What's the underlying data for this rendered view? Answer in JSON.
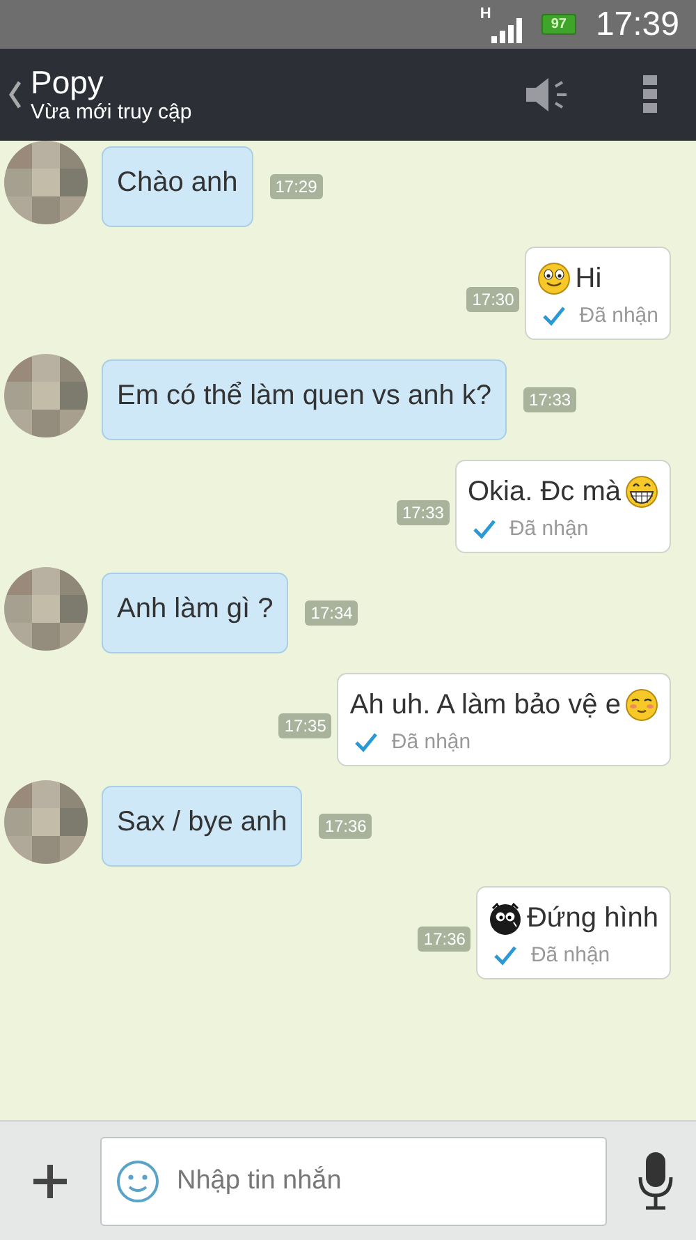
{
  "status_bar": {
    "network": "H",
    "battery": "97",
    "time": "17:39"
  },
  "header": {
    "title": "Popy",
    "subtitle": "Vừa mới truy cập"
  },
  "messages": [
    {
      "kind": "incoming",
      "content": [
        {
          "kind": "text",
          "text": "Chào anh"
        }
      ],
      "time": "17:29"
    },
    {
      "kind": "outgoing",
      "content": [
        {
          "kind": "smile"
        },
        {
          "kind": "text",
          "text": "Hi"
        }
      ],
      "time": "17:30",
      "status": "Đã nhận"
    },
    {
      "kind": "incoming",
      "content": [
        {
          "kind": "text",
          "text": "Em có thể làm quen vs anh k?"
        }
      ],
      "time": "17:33"
    },
    {
      "kind": "outgoing",
      "content": [
        {
          "kind": "text",
          "text": "Okia. Đc mà"
        },
        {
          "kind": "grin"
        }
      ],
      "time": "17:33",
      "status": "Đã nhận"
    },
    {
      "kind": "incoming",
      "content": [
        {
          "kind": "text",
          "text": "Anh làm gì ?"
        }
      ],
      "time": "17:34"
    },
    {
      "kind": "outgoing",
      "content": [
        {
          "kind": "text",
          "text": "Ah uh. A làm bảo vệ e"
        },
        {
          "kind": "blush"
        }
      ],
      "time": "17:35",
      "status": "Đã nhận"
    },
    {
      "kind": "incoming",
      "content": [
        {
          "kind": "text",
          "text": "Sax / bye anh"
        }
      ],
      "time": "17:36"
    },
    {
      "kind": "outgoing",
      "content": [
        {
          "kind": "owl"
        },
        {
          "kind": "text",
          "text": "Đứng hình"
        }
      ],
      "time": "17:36",
      "status": "Đã nhận"
    }
  ],
  "composer": {
    "placeholder": "Nhập tin nhắn"
  }
}
